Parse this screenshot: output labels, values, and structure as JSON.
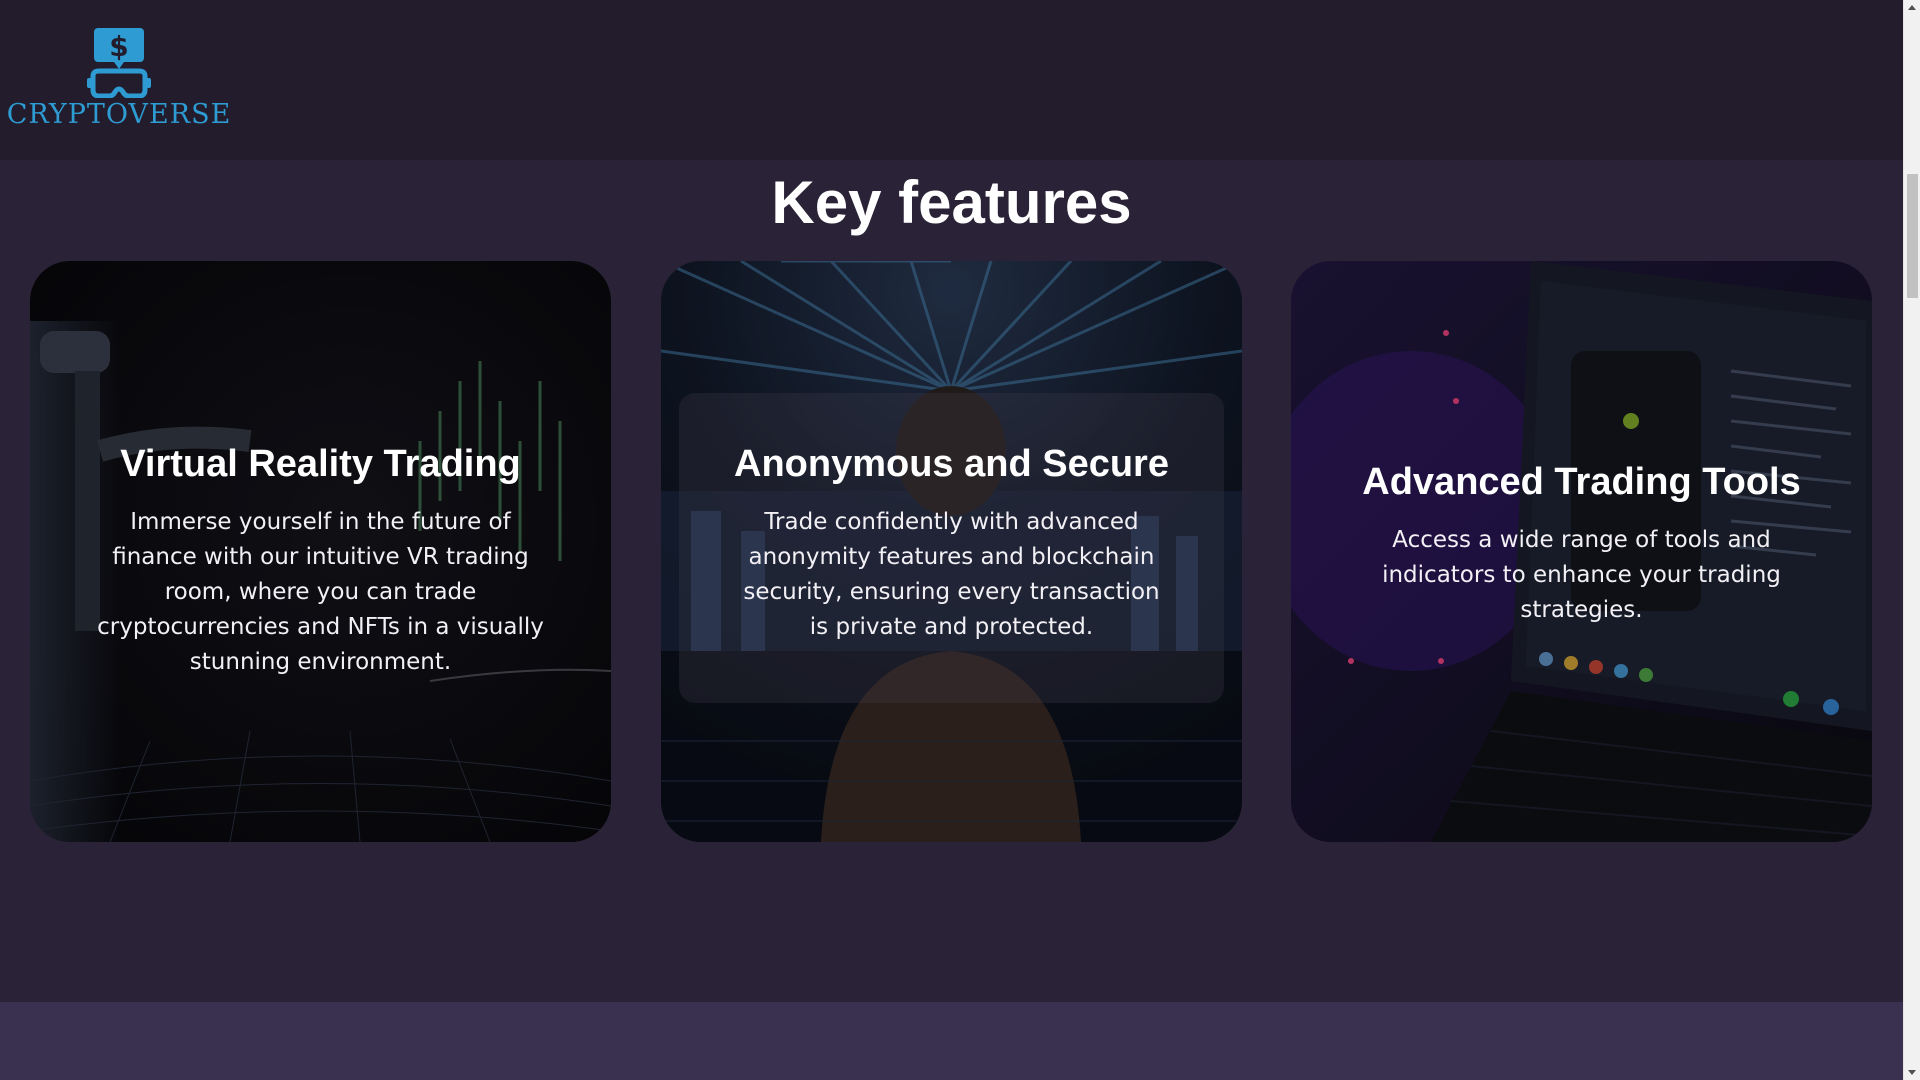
{
  "brand": {
    "name": "CRYPTOVERSE",
    "logo_icon": "vr-headset-dollar-icon",
    "color": "#2e9bd3"
  },
  "features": {
    "title": "Key features",
    "cards": [
      {
        "title": "Virtual Reality Trading",
        "text": "Immerse yourself in the future of finance with our intuitive VR trading room, where you can trade cryptocurrencies and NFTs in a visually stunning environment.",
        "image": "vr-trader-chart-image"
      },
      {
        "title": "Anonymous and Secure",
        "text": "Trade confidently with advanced anonymity features and blockchain security, ensuring every transaction is private and protected.",
        "image": "hooded-figure-city-image"
      },
      {
        "title": "Advanced Trading Tools",
        "text": "Access a wide range of tools and indicators to enhance your trading strategies.",
        "image": "laptop-code-image"
      }
    ]
  },
  "colors": {
    "page_bg": "#2a2236",
    "header_bg": "#221c2c",
    "footer_bg": "#3a3150"
  }
}
